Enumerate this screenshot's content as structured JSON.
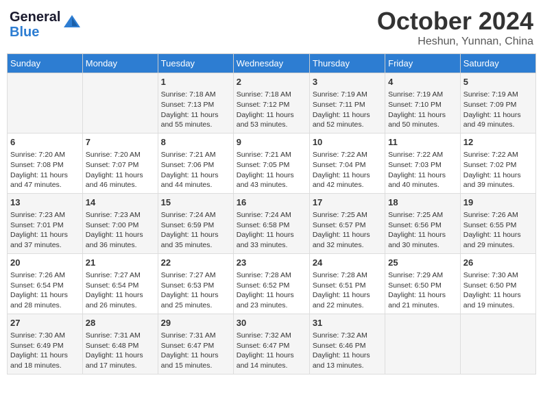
{
  "logo": {
    "line1": "General",
    "line2": "Blue"
  },
  "title": "October 2024",
  "location": "Heshun, Yunnan, China",
  "days_of_week": [
    "Sunday",
    "Monday",
    "Tuesday",
    "Wednesday",
    "Thursday",
    "Friday",
    "Saturday"
  ],
  "weeks": [
    {
      "days": [
        {
          "num": "",
          "info": ""
        },
        {
          "num": "",
          "info": ""
        },
        {
          "num": "1",
          "info": "Sunrise: 7:18 AM\nSunset: 7:13 PM\nDaylight: 11 hours and 55 minutes."
        },
        {
          "num": "2",
          "info": "Sunrise: 7:18 AM\nSunset: 7:12 PM\nDaylight: 11 hours and 53 minutes."
        },
        {
          "num": "3",
          "info": "Sunrise: 7:19 AM\nSunset: 7:11 PM\nDaylight: 11 hours and 52 minutes."
        },
        {
          "num": "4",
          "info": "Sunrise: 7:19 AM\nSunset: 7:10 PM\nDaylight: 11 hours and 50 minutes."
        },
        {
          "num": "5",
          "info": "Sunrise: 7:19 AM\nSunset: 7:09 PM\nDaylight: 11 hours and 49 minutes."
        }
      ]
    },
    {
      "days": [
        {
          "num": "6",
          "info": "Sunrise: 7:20 AM\nSunset: 7:08 PM\nDaylight: 11 hours and 47 minutes."
        },
        {
          "num": "7",
          "info": "Sunrise: 7:20 AM\nSunset: 7:07 PM\nDaylight: 11 hours and 46 minutes."
        },
        {
          "num": "8",
          "info": "Sunrise: 7:21 AM\nSunset: 7:06 PM\nDaylight: 11 hours and 44 minutes."
        },
        {
          "num": "9",
          "info": "Sunrise: 7:21 AM\nSunset: 7:05 PM\nDaylight: 11 hours and 43 minutes."
        },
        {
          "num": "10",
          "info": "Sunrise: 7:22 AM\nSunset: 7:04 PM\nDaylight: 11 hours and 42 minutes."
        },
        {
          "num": "11",
          "info": "Sunrise: 7:22 AM\nSunset: 7:03 PM\nDaylight: 11 hours and 40 minutes."
        },
        {
          "num": "12",
          "info": "Sunrise: 7:22 AM\nSunset: 7:02 PM\nDaylight: 11 hours and 39 minutes."
        }
      ]
    },
    {
      "days": [
        {
          "num": "13",
          "info": "Sunrise: 7:23 AM\nSunset: 7:01 PM\nDaylight: 11 hours and 37 minutes."
        },
        {
          "num": "14",
          "info": "Sunrise: 7:23 AM\nSunset: 7:00 PM\nDaylight: 11 hours and 36 minutes."
        },
        {
          "num": "15",
          "info": "Sunrise: 7:24 AM\nSunset: 6:59 PM\nDaylight: 11 hours and 35 minutes."
        },
        {
          "num": "16",
          "info": "Sunrise: 7:24 AM\nSunset: 6:58 PM\nDaylight: 11 hours and 33 minutes."
        },
        {
          "num": "17",
          "info": "Sunrise: 7:25 AM\nSunset: 6:57 PM\nDaylight: 11 hours and 32 minutes."
        },
        {
          "num": "18",
          "info": "Sunrise: 7:25 AM\nSunset: 6:56 PM\nDaylight: 11 hours and 30 minutes."
        },
        {
          "num": "19",
          "info": "Sunrise: 7:26 AM\nSunset: 6:55 PM\nDaylight: 11 hours and 29 minutes."
        }
      ]
    },
    {
      "days": [
        {
          "num": "20",
          "info": "Sunrise: 7:26 AM\nSunset: 6:54 PM\nDaylight: 11 hours and 28 minutes."
        },
        {
          "num": "21",
          "info": "Sunrise: 7:27 AM\nSunset: 6:54 PM\nDaylight: 11 hours and 26 minutes."
        },
        {
          "num": "22",
          "info": "Sunrise: 7:27 AM\nSunset: 6:53 PM\nDaylight: 11 hours and 25 minutes."
        },
        {
          "num": "23",
          "info": "Sunrise: 7:28 AM\nSunset: 6:52 PM\nDaylight: 11 hours and 23 minutes."
        },
        {
          "num": "24",
          "info": "Sunrise: 7:28 AM\nSunset: 6:51 PM\nDaylight: 11 hours and 22 minutes."
        },
        {
          "num": "25",
          "info": "Sunrise: 7:29 AM\nSunset: 6:50 PM\nDaylight: 11 hours and 21 minutes."
        },
        {
          "num": "26",
          "info": "Sunrise: 7:30 AM\nSunset: 6:50 PM\nDaylight: 11 hours and 19 minutes."
        }
      ]
    },
    {
      "days": [
        {
          "num": "27",
          "info": "Sunrise: 7:30 AM\nSunset: 6:49 PM\nDaylight: 11 hours and 18 minutes."
        },
        {
          "num": "28",
          "info": "Sunrise: 7:31 AM\nSunset: 6:48 PM\nDaylight: 11 hours and 17 minutes."
        },
        {
          "num": "29",
          "info": "Sunrise: 7:31 AM\nSunset: 6:47 PM\nDaylight: 11 hours and 15 minutes."
        },
        {
          "num": "30",
          "info": "Sunrise: 7:32 AM\nSunset: 6:47 PM\nDaylight: 11 hours and 14 minutes."
        },
        {
          "num": "31",
          "info": "Sunrise: 7:32 AM\nSunset: 6:46 PM\nDaylight: 11 hours and 13 minutes."
        },
        {
          "num": "",
          "info": ""
        },
        {
          "num": "",
          "info": ""
        }
      ]
    }
  ]
}
